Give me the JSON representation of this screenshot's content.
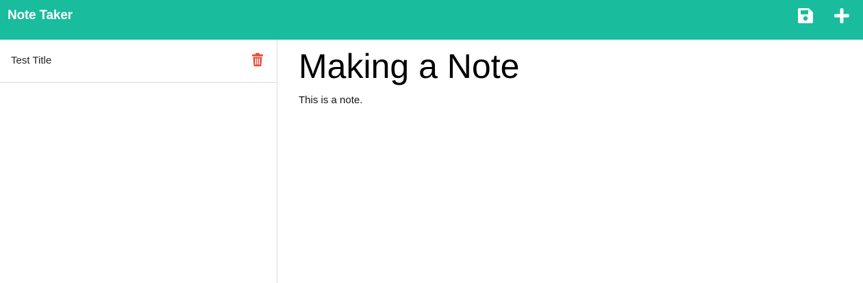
{
  "app": {
    "brand": "Note Taker",
    "accent_color": "#19bc9c"
  },
  "toolbar": {
    "save_icon": "save-icon",
    "new_icon": "plus-icon"
  },
  "sidebar": {
    "items": [
      {
        "title": "Test Title",
        "delete_icon": "trash-icon",
        "delete_color": "#e64c3c"
      }
    ]
  },
  "note": {
    "title": "Making a Note",
    "text": "This is a note."
  }
}
